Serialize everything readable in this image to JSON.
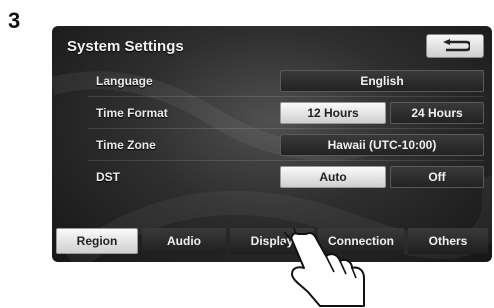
{
  "step_number": "3",
  "screen": {
    "title": "System Settings",
    "back_icon": "back-arrow-icon",
    "rows": [
      {
        "label": "Language",
        "options": [
          "English"
        ],
        "selected": "English"
      },
      {
        "label": "Time Format",
        "options": [
          "12 Hours",
          "24 Hours"
        ],
        "selected": "12 Hours"
      },
      {
        "label": "Time Zone",
        "options": [
          "Hawaii (UTC-10:00)"
        ],
        "selected": "Hawaii (UTC-10:00)"
      },
      {
        "label": "DST",
        "options": [
          "Auto",
          "Off"
        ],
        "selected": "Auto"
      }
    ],
    "tabs": [
      "Region",
      "Audio",
      "Display",
      "Connection",
      "Others"
    ],
    "active_tab": "Region",
    "pressed_tab": "Display"
  },
  "gesture_icon": "pointing-hand-icon"
}
